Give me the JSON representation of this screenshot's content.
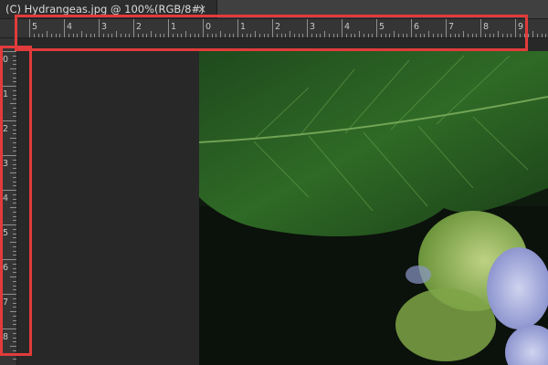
{
  "document": {
    "tab_title": "(C) Hydrangeas.jpg @ 100%(RGB/8#)",
    "close_glyph": "×"
  },
  "rulers": {
    "horizontal_labels": [
      "5",
      "4",
      "3",
      "2",
      "1",
      "0",
      "1",
      "2",
      "3",
      "4",
      "5",
      "6",
      "7",
      "8",
      "9"
    ],
    "vertical_labels": [
      "0",
      "1",
      "2",
      "3",
      "4",
      "5",
      "6",
      "7",
      "8"
    ]
  },
  "colors": {
    "highlight": "#e23b3b",
    "workspace": "#262626",
    "ruler": "#353535"
  },
  "image": {
    "subject_icon": "photo-hydrangea-leaf"
  }
}
